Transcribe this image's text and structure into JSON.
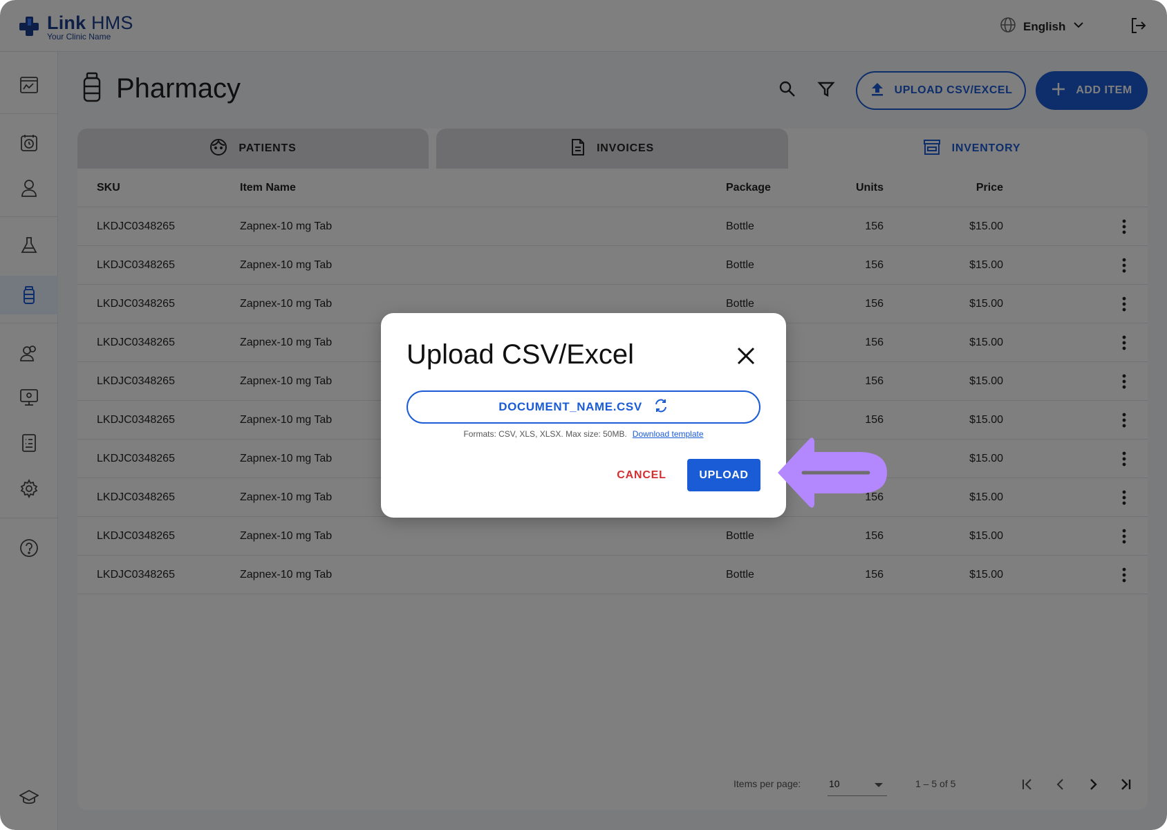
{
  "app": {
    "brand_name_bold": "Link",
    "brand_name_rest": " HMS",
    "brand_subtitle": "Your Clinic Name",
    "language": "English"
  },
  "sidebar": {
    "icons": [
      "dashboard-icon",
      "appointments-icon",
      "patient-icon",
      "lab-icon",
      "pharmacy-icon",
      "staff-icon",
      "monitor-icon",
      "reports-icon",
      "settings-icon",
      "help-icon",
      "academy-icon"
    ],
    "active": "pharmacy-icon"
  },
  "page": {
    "title": "Pharmacy",
    "upload_label": "UPLOAD CSV/EXCEL",
    "add_label": "ADD ITEM"
  },
  "tabs": [
    {
      "label": "PATIENTS",
      "icon": "face-icon",
      "active": false
    },
    {
      "label": "INVOICES",
      "icon": "document-icon",
      "active": false
    },
    {
      "label": "INVENTORY",
      "icon": "store-icon",
      "active": true
    }
  ],
  "table": {
    "headers": {
      "sku": "SKU",
      "name": "Item Name",
      "package": "Package",
      "units": "Units",
      "price": "Price"
    },
    "rows": [
      {
        "sku": "LKDJC0348265",
        "name": "Zapnex-10 mg Tab",
        "package": "Bottle",
        "units": "156",
        "price": "$15.00"
      },
      {
        "sku": "LKDJC0348265",
        "name": "Zapnex-10 mg Tab",
        "package": "Bottle",
        "units": "156",
        "price": "$15.00"
      },
      {
        "sku": "LKDJC0348265",
        "name": "Zapnex-10 mg Tab",
        "package": "Bottle",
        "units": "156",
        "price": "$15.00"
      },
      {
        "sku": "LKDJC0348265",
        "name": "Zapnex-10 mg Tab",
        "package": "",
        "units": "156",
        "price": "$15.00"
      },
      {
        "sku": "LKDJC0348265",
        "name": "Zapnex-10 mg Tab",
        "package": "",
        "units": "156",
        "price": "$15.00"
      },
      {
        "sku": "LKDJC0348265",
        "name": "Zapnex-10 mg Tab",
        "package": "",
        "units": "156",
        "price": "$15.00"
      },
      {
        "sku": "LKDJC0348265",
        "name": "Zapnex-10 mg Tab",
        "package": "",
        "units": "",
        "price": "$15.00"
      },
      {
        "sku": "LKDJC0348265",
        "name": "Zapnex-10 mg Tab",
        "package": "",
        "units": "156",
        "price": "$15.00"
      },
      {
        "sku": "LKDJC0348265",
        "name": "Zapnex-10 mg Tab",
        "package": "Bottle",
        "units": "156",
        "price": "$15.00"
      },
      {
        "sku": "LKDJC0348265",
        "name": "Zapnex-10 mg Tab",
        "package": "Bottle",
        "units": "156",
        "price": "$15.00"
      }
    ]
  },
  "pagination": {
    "items_per_page_label": "Items per page:",
    "items_per_page": "10",
    "range": "1 – 5 of 5"
  },
  "dialog": {
    "title": "Upload CSV/Excel",
    "file_name": "DOCUMENT_NAME.CSV",
    "hint": "Formats: CSV, XLS, XLSX. Max size: 50MB.",
    "template_link": "Download template",
    "cancel_label": "CANCEL",
    "upload_label": "UPLOAD"
  },
  "colors": {
    "primary": "#1a5bd6",
    "danger": "#d32f2f",
    "annotation_arrow": "#b388ff",
    "brand": "#1b3f8f"
  }
}
